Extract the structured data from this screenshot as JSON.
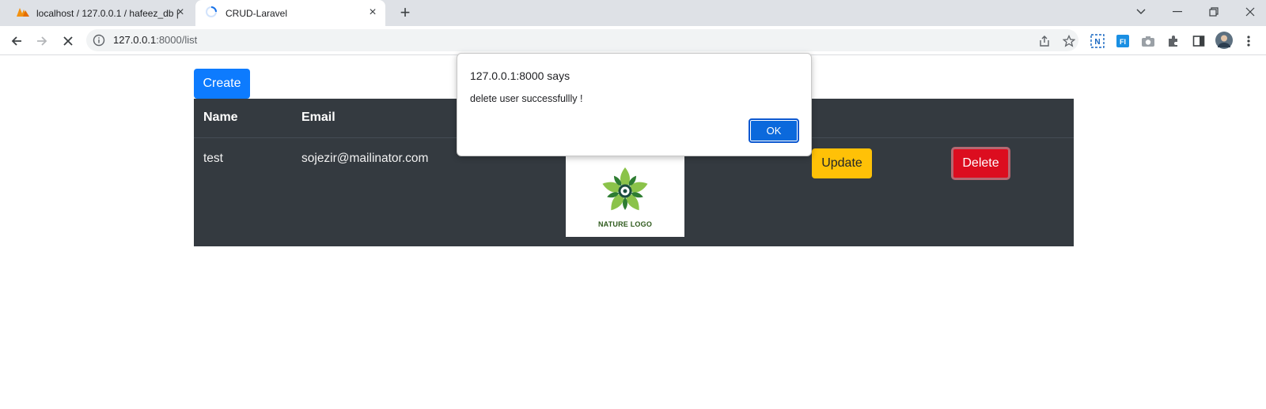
{
  "browser": {
    "tabs": [
      {
        "title": "localhost / 127.0.0.1 / hafeez_db |",
        "favicon": "phpmyadmin-icon",
        "active": false
      },
      {
        "title": "CRUD-Laravel",
        "favicon": "loading-spinner-icon",
        "active": true
      }
    ],
    "new_tab_label": "+",
    "close_label": "×",
    "url_host": "127.0.0.1",
    "url_path": ":8000/list",
    "extensions": [
      "share-icon",
      "star-icon",
      "n-extension-icon",
      "fi-extension-icon",
      "camera-icon",
      "puzzle-icon",
      "side-panel-icon",
      "profile-avatar",
      "menu-icon"
    ]
  },
  "page": {
    "create_label": "Create",
    "table": {
      "headers": [
        "Name",
        "Email"
      ],
      "rows": [
        {
          "name": "test",
          "email": "sojezir@mailinator.com",
          "image_text": "NATURE LOGO",
          "update_label": "Update",
          "delete_label": "Delete"
        }
      ]
    }
  },
  "dialog": {
    "title": "127.0.0.1:8000 says",
    "message": "delete user successfullly !",
    "ok_label": "OK"
  },
  "colors": {
    "primary": "#0d7bfe",
    "warning": "#ffc107",
    "danger": "#dc0d1f",
    "table_dark": "#343a40"
  }
}
